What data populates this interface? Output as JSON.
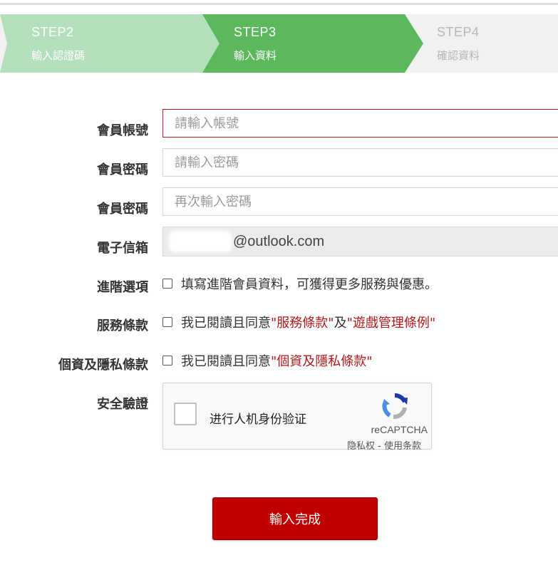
{
  "steps": [
    {
      "title": "STEP2",
      "subtitle": "輸入認證碼",
      "state": "done"
    },
    {
      "title": "STEP3",
      "subtitle": "輸入資料",
      "state": "active"
    },
    {
      "title": "STEP4",
      "subtitle": "確認資料",
      "state": "pending"
    }
  ],
  "form": {
    "account": {
      "label": "會員帳號",
      "placeholder": "請輸入帳號",
      "value": ""
    },
    "password": {
      "label": "會員密碼",
      "placeholder": "請輸入密碼",
      "value": ""
    },
    "password_confirm": {
      "label": "會員密碼",
      "placeholder": "再次輸入密碼",
      "value": ""
    },
    "email": {
      "label": "電子信箱",
      "suffix": "@outlook.com"
    },
    "advanced": {
      "label": "進階選項",
      "text": "填寫進階會員資料，可獲得更多服務與優惠。",
      "checked": false
    },
    "terms": {
      "label": "服務條款",
      "prefix": "我已閱讀且同意",
      "link1": "\"服務條款\"",
      "mid": "及",
      "link2": "\"遊戲管理條例\"",
      "checked": false
    },
    "privacy": {
      "label": "個資及隱私條款",
      "prefix": "我已閱讀且同意",
      "link": "\"個資及隱私條款\"",
      "checked": false
    },
    "security": {
      "label": "安全驗證"
    }
  },
  "recaptcha": {
    "checkbox_text": "进行人机身份验证",
    "brand": "reCAPTCHA",
    "privacy_link": "隐私权",
    "separator": " - ",
    "terms_link": "使用条款",
    "logo_icon": "recaptcha-logo-icon"
  },
  "submit": {
    "label": "輸入完成"
  },
  "colors": {
    "step_done": "#b4dfbc",
    "step_active": "#5cb85c",
    "step_pending": "#f1f1f1",
    "submit": "#c00000",
    "link_red": "#b01a1a",
    "focus_border": "#b22222"
  }
}
